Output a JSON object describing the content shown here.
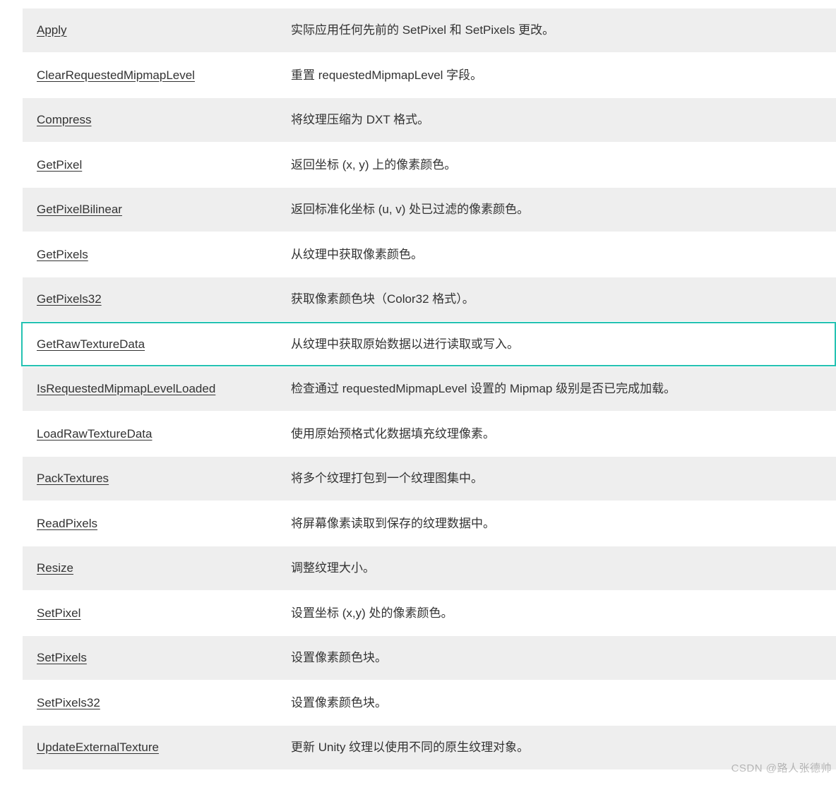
{
  "highlighted_method": "GetRawTextureData",
  "methods": [
    {
      "name": "Apply",
      "description": "实际应用任何先前的 SetPixel 和 SetPixels 更改。"
    },
    {
      "name": "ClearRequestedMipmapLevel",
      "description": "重置 requestedMipmapLevel 字段。"
    },
    {
      "name": "Compress",
      "description": "将纹理压缩为 DXT 格式。"
    },
    {
      "name": "GetPixel",
      "description": "返回坐标 (x, y) 上的像素颜色。"
    },
    {
      "name": "GetPixelBilinear",
      "description": "返回标准化坐标 (u, v) 处已过滤的像素颜色。"
    },
    {
      "name": "GetPixels",
      "description": "从纹理中获取像素颜色。"
    },
    {
      "name": "GetPixels32",
      "description": "获取像素颜色块（Color32 格式）。"
    },
    {
      "name": "GetRawTextureData",
      "description": "从纹理中获取原始数据以进行读取或写入。"
    },
    {
      "name": "IsRequestedMipmapLevelLoaded",
      "description": "检查通过 requestedMipmapLevel 设置的 Mipmap 级别是否已完成加载。"
    },
    {
      "name": "LoadRawTextureData",
      "description": "使用原始预格式化数据填充纹理像素。"
    },
    {
      "name": "PackTextures",
      "description": "将多个纹理打包到一个纹理图集中。"
    },
    {
      "name": "ReadPixels",
      "description": "将屏幕像素读取到保存的纹理数据中。"
    },
    {
      "name": "Resize",
      "description": "调整纹理大小。"
    },
    {
      "name": "SetPixel",
      "description": "设置坐标 (x,y) 处的像素颜色。"
    },
    {
      "name": "SetPixels",
      "description": "设置像素颜色块。"
    },
    {
      "name": "SetPixels32",
      "description": "设置像素颜色块。"
    },
    {
      "name": "UpdateExternalTexture",
      "description": "更新 Unity 纹理以使用不同的原生纹理对象。"
    }
  ],
  "watermark": "CSDN @路人张德帅"
}
